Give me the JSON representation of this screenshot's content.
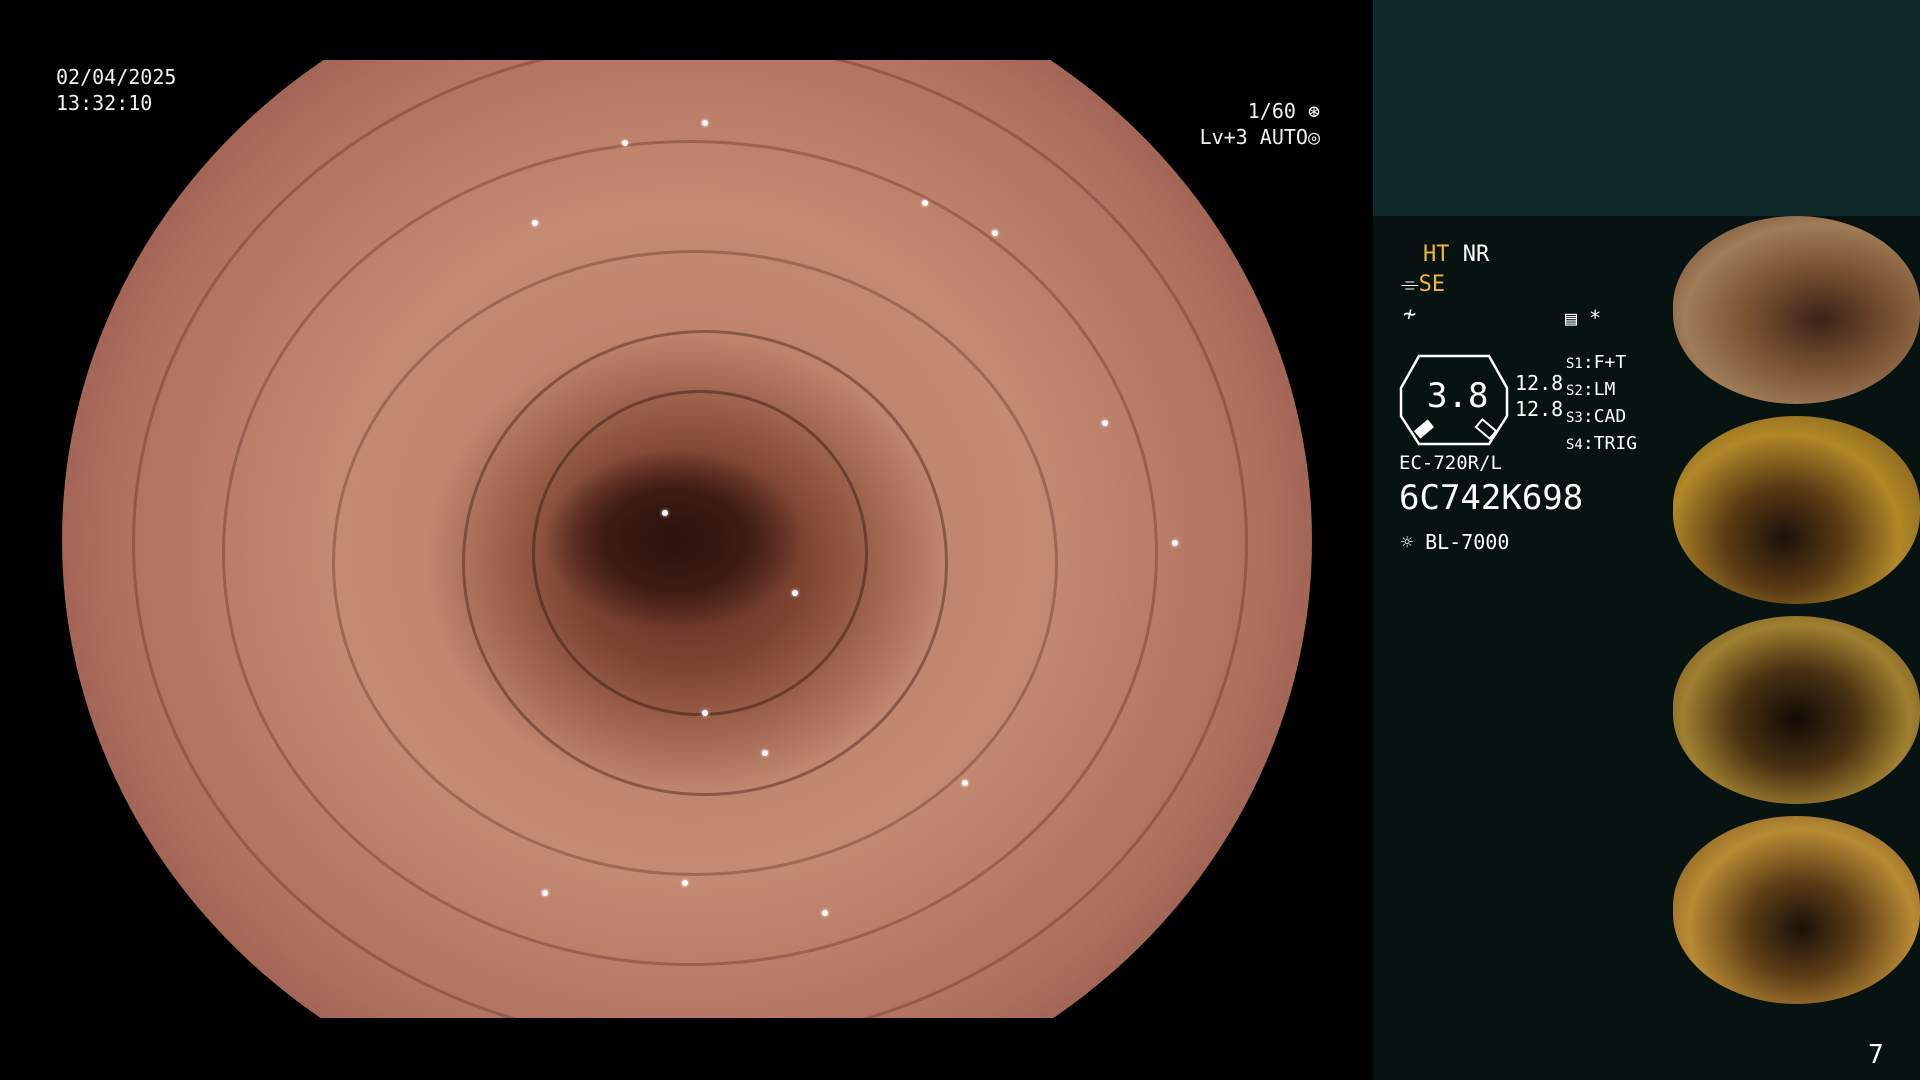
{
  "overlay": {
    "date": "02/04/2025",
    "time": "13:32:10",
    "shutter": "1/60",
    "shutter_icon": "shutter-icon",
    "enhance_level": "Lv+3",
    "iris_mode": "AUTO",
    "iris_icon": "iris-icon"
  },
  "panel": {
    "mode_ht": "HT",
    "mode_nr": "NR",
    "mode_se": "SE",
    "icons": [
      "signal-icon",
      "waveform-icon",
      "menu-grid-icon"
    ],
    "asterisk": "*",
    "magnification": "3.8",
    "value_1": "12.8",
    "value_2": "12.8",
    "switches": [
      {
        "key": "S1",
        "value": "F+T"
      },
      {
        "key": "S2",
        "value": "LM"
      },
      {
        "key": "S3",
        "value": "CAD"
      },
      {
        "key": "S4",
        "value": "TRIG"
      }
    ],
    "scope_model": "EC-720R/L",
    "scope_serial": "6C742K698",
    "light_source": "BL-7000",
    "page_number": "7"
  },
  "colors": {
    "accent": "#f2b53a",
    "panel_dark": "#071311",
    "panel_top": "#0e2a28"
  }
}
